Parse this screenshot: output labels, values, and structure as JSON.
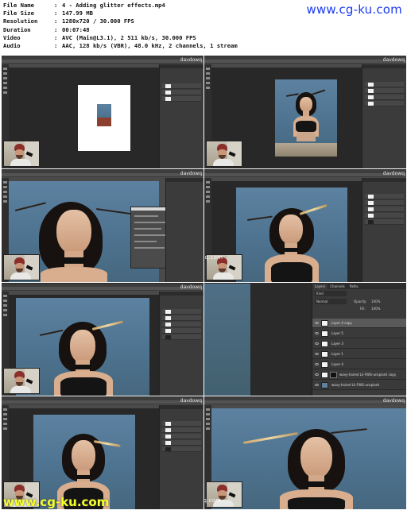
{
  "header": {
    "rows": [
      {
        "key": "File Name",
        "value": "4 - Adding glitter effects.mp4"
      },
      {
        "key": "File Size",
        "value": "147.99 MB"
      },
      {
        "key": "Resolution",
        "value": "1280x720 / 30.000 FPS"
      },
      {
        "key": "Duration",
        "value": "00:07:48"
      },
      {
        "key": "Video",
        "value": "AVC (Main@L3.1), 2 511 kb/s, 30.000 FPS"
      },
      {
        "key": "Audio",
        "value": "AAC, 128 kb/s (VBR), 48.0 kHz, 2 channels, 1 stream"
      }
    ],
    "separator": ":"
  },
  "watermarks": {
    "top": "www.cg-ku.com",
    "bottom": "www.cg-ku.com",
    "frame": "davdowq.com",
    "frame_corner": "davdowq"
  },
  "layers_panel": {
    "tabs": [
      "Layers",
      "Channels",
      "Paths"
    ],
    "filter": "Kind",
    "blend_mode": "Normal",
    "opacity_label": "Opacity:",
    "opacity_value": "100%",
    "fill_label": "Fill:",
    "fill_value": "100%",
    "layers": [
      {
        "name": "Layer 4 copy",
        "selected": true
      },
      {
        "name": "Layer 5"
      },
      {
        "name": "Layer 3"
      },
      {
        "name": "Layer 1"
      },
      {
        "name": "Layer 4"
      },
      {
        "name": "wavy-haired Lil-FWG-unsplash copy"
      },
      {
        "name": "wavy-haired Lil-FWG-unsplash"
      }
    ]
  }
}
